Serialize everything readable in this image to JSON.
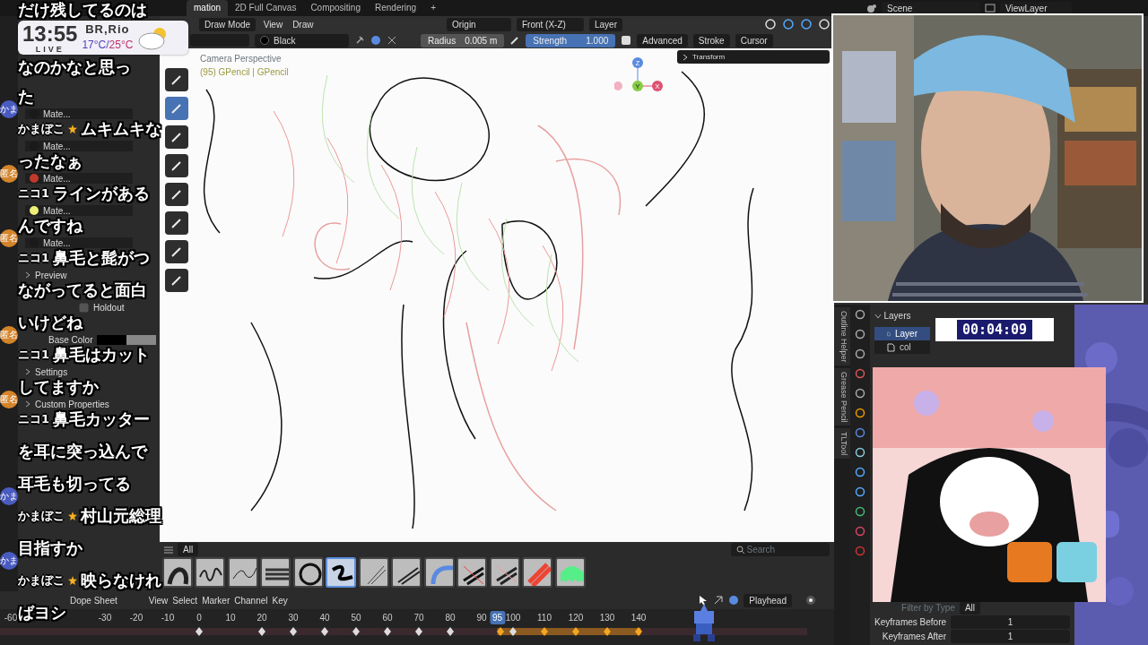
{
  "top_bar": {
    "tabs": [
      {
        "label": "mation",
        "selected": true
      },
      {
        "label": "2D Full Canvas",
        "selected": false
      },
      {
        "label": "Compositing",
        "selected": false
      },
      {
        "label": "Rendering",
        "selected": false
      }
    ],
    "add_tab": "+",
    "scene": "Scene",
    "view_layer": "ViewLayer"
  },
  "header": {
    "mode": "Draw Mode",
    "menus": [
      "View",
      "Draw"
    ],
    "pivot": "Origin",
    "view": "Front (X-Z)",
    "layer": "Layer"
  },
  "tool_settings": {
    "material": "Black",
    "radius_label": "Radius",
    "radius": "0.005 m",
    "strength_label": "Strength",
    "strength": "1.000",
    "menus": [
      "Advanced",
      "Stroke",
      "Cursor"
    ]
  },
  "viewport": {
    "camera": "Camera Perspective",
    "object": "(95) GPencil | GPencil",
    "transform_panel": "Transform",
    "gizmo_axes": [
      "Z",
      "Y",
      "X"
    ]
  },
  "materials": [
    {
      "name": "Mate...",
      "color": "#1a1a1a"
    },
    {
      "name": "Mate...",
      "color": "#1a1a1a"
    },
    {
      "name": "Mate...",
      "color": "#c0392b"
    },
    {
      "name": "Mate...",
      "color": "#eef07a"
    },
    {
      "name": "Mate...",
      "color": "#1a1a1a"
    }
  ],
  "property_rows": [
    {
      "kind": "section",
      "label": "Preview"
    },
    {
      "kind": "checkbox",
      "label": "Holdout",
      "checked": false
    },
    {
      "kind": "color",
      "label": "Base Color"
    },
    {
      "kind": "section",
      "label": "Settings"
    },
    {
      "kind": "section",
      "label": "Custom Properties"
    }
  ],
  "brush_bar": {
    "filter": "All",
    "search_placeholder": "Search",
    "brushes": [
      {
        "selected": false
      },
      {
        "selected": false
      },
      {
        "selected": false
      },
      {
        "selected": false
      },
      {
        "selected": false
      },
      {
        "selected": true
      },
      {
        "selected": false
      },
      {
        "selected": false
      },
      {
        "selected": false
      },
      {
        "selected": false
      },
      {
        "selected": false
      },
      {
        "selected": false
      },
      {
        "selected": false
      }
    ]
  },
  "timeline": {
    "editor": "Dope Sheet",
    "menus": [
      "View",
      "Select",
      "Marker",
      "Channel",
      "Key"
    ],
    "playhead_mode": "Playhead",
    "ticks": [
      "-60",
      "-30",
      "-20",
      "-10",
      "0",
      "10",
      "20",
      "30",
      "40",
      "50",
      "60",
      "70",
      "80",
      "90",
      "100",
      "110",
      "120",
      "130",
      "140"
    ],
    "current_frame": "95"
  },
  "clock": {
    "time": "13:55",
    "live": "LIVE",
    "city": "BR,Rio",
    "low": "17°C/",
    "high": "25°C"
  },
  "comments": [
    {
      "lines": [
        "だけ残してるのは",
        "なのかなと思っ",
        "た"
      ]
    },
    {
      "avatar": "かま",
      "user": "かまぼこ",
      "star": true,
      "lines": [
        "ムキムキな",
        "ったなぁ"
      ]
    },
    {
      "avatar": "匿名",
      "user": "ニコ1",
      "star": false,
      "lines": [
        "ラインがある",
        "んですね"
      ]
    },
    {
      "avatar": "匿名",
      "user": "ニコ1",
      "star": false,
      "lines": [
        "鼻毛と髭がつ",
        "ながってると面白",
        "いけどね"
      ]
    },
    {
      "avatar": "匿名",
      "user": "ニコ1",
      "star": false,
      "lines": [
        "鼻毛はカット",
        "してますか"
      ]
    },
    {
      "avatar": "匿名",
      "user": "ニコ1",
      "star": false,
      "lines": [
        "鼻毛カッター",
        "を耳に突っ込んで",
        "耳毛も切ってる"
      ]
    },
    {
      "avatar": "かま",
      "user": "かまぼこ",
      "star": true,
      "lines": [
        "村山元総理",
        "目指すか"
      ]
    },
    {
      "avatar": "かま",
      "user": "かまぼこ",
      "star": true,
      "lines": [
        "映らなけれ",
        "ばヨシ"
      ]
    }
  ],
  "timer": "00:04:09",
  "right_panel": {
    "tabs": [
      {
        "label": "Outline Helper",
        "selected": false
      },
      {
        "label": "Grease Pencil",
        "selected": false
      },
      {
        "label": "TLTool",
        "selected": false
      }
    ],
    "section": "Layers",
    "layers": [
      {
        "name": "Layer",
        "selected": true
      },
      {
        "name": "col",
        "selected": false
      }
    ],
    "filter_label": "Filter by Type",
    "filter_value": "All",
    "fields": [
      {
        "label": "Keyframes Before",
        "value": "1"
      },
      {
        "label": "Keyframes After",
        "value": "1"
      }
    ]
  }
}
